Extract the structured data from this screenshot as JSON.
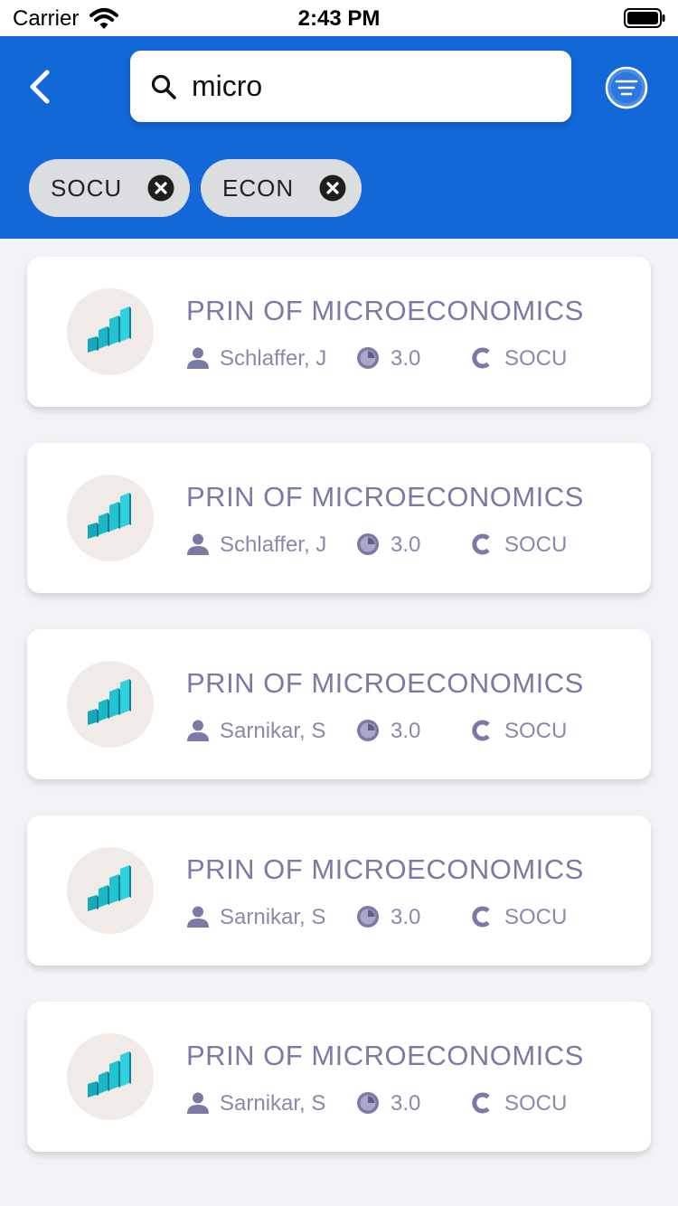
{
  "status_bar": {
    "carrier": "Carrier",
    "time": "2:43 PM"
  },
  "header": {
    "background_color": "#1268d8",
    "back_icon": "chevron-left-icon",
    "filter_icon": "filter-list-icon"
  },
  "search": {
    "value": "micro",
    "icon": "search-icon"
  },
  "filter_chips": [
    {
      "label": "SOCU"
    },
    {
      "label": "ECON"
    }
  ],
  "courses": [
    {
      "title": "PRIN OF MICROECONOMICS",
      "instructor": "Schlaffer, J",
      "credits": "3.0",
      "subject": "SOCU"
    },
    {
      "title": "PRIN OF MICROECONOMICS",
      "instructor": "Schlaffer, J",
      "credits": "3.0",
      "subject": "SOCU"
    },
    {
      "title": "PRIN OF MICROECONOMICS",
      "instructor": "Sarnikar, S",
      "credits": "3.0",
      "subject": "SOCU"
    },
    {
      "title": "PRIN OF MICROECONOMICS",
      "instructor": "Sarnikar, S",
      "credits": "3.0",
      "subject": "SOCU"
    },
    {
      "title": "PRIN OF MICROECONOMICS",
      "instructor": "Sarnikar, S",
      "credits": "3.0",
      "subject": "SOCU"
    }
  ],
  "colors": {
    "accent": "#1268d8",
    "card_text": "#7b7aa6",
    "bar_chart_icon": "#1ab8c9"
  }
}
